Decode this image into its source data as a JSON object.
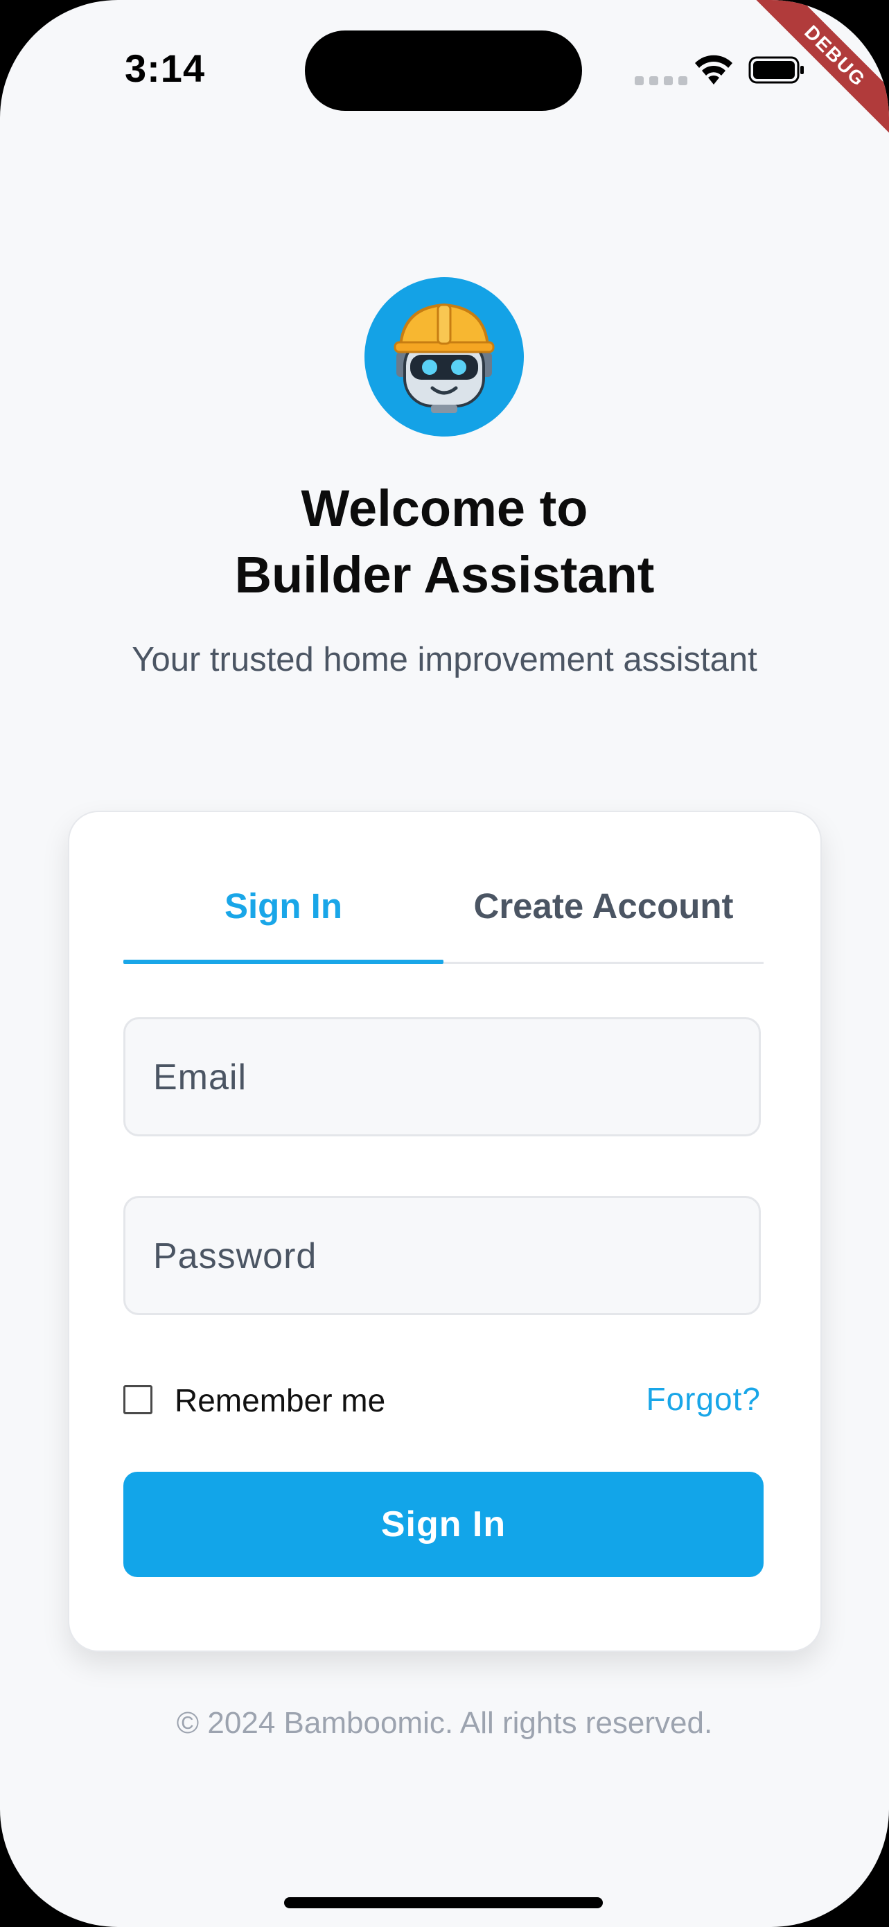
{
  "status_bar": {
    "time": "3:14",
    "debug_label": "DEBUG"
  },
  "header": {
    "logo_icon": "robot-construction-helmet-icon",
    "title_line1": "Welcome to",
    "title_line2": "Builder Assistant",
    "subtitle": "Your trusted home improvement assistant"
  },
  "auth_card": {
    "tabs": [
      {
        "label": "Sign In",
        "active": true
      },
      {
        "label": "Create Account",
        "active": false
      }
    ],
    "email": {
      "placeholder": "Email",
      "value": ""
    },
    "password": {
      "placeholder": "Password",
      "value": ""
    },
    "remember_label": "Remember me",
    "remember_checked": false,
    "forgot_label": "Forgot?",
    "submit_label": "Sign In"
  },
  "footer": {
    "copyright": "© 2024 Bamboomic. All rights reserved."
  },
  "colors": {
    "accent": "#12a5e9",
    "background": "#f7f8fa",
    "debug_banner": "#b13b3b"
  }
}
